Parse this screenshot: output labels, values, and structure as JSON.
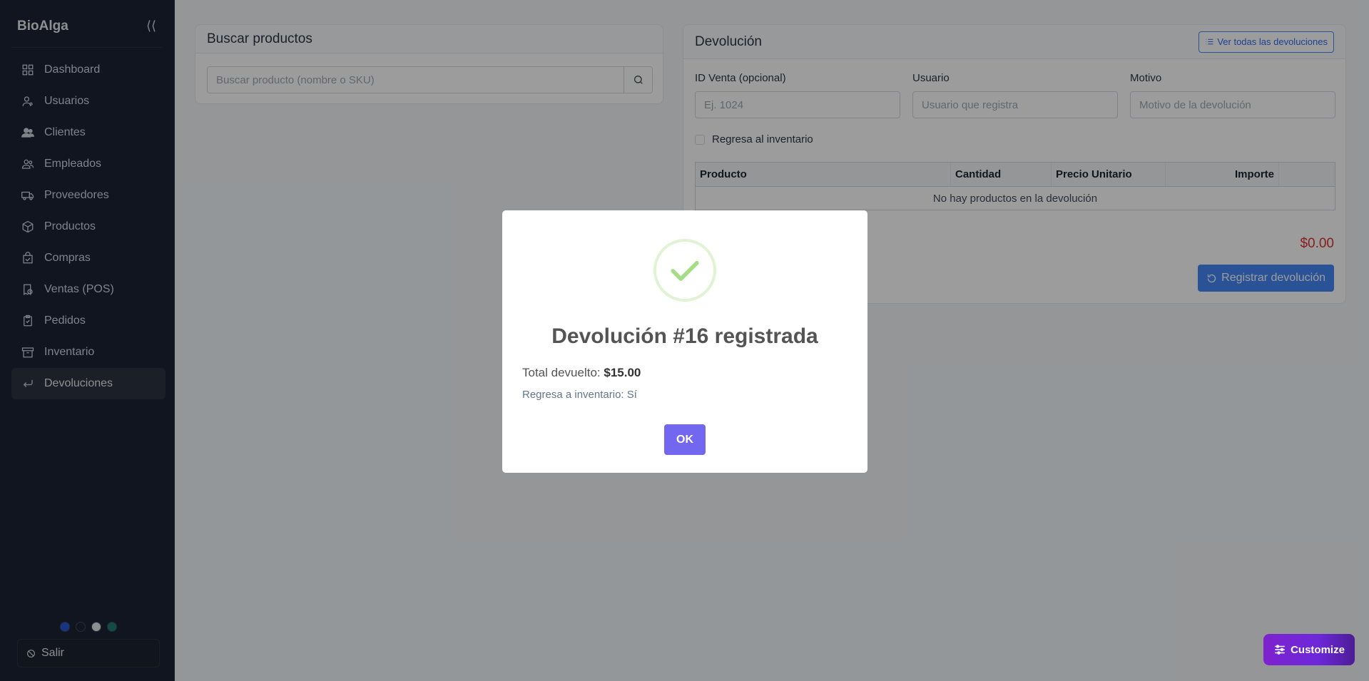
{
  "sidebar": {
    "brand": "BioAlga",
    "collapse_icon": "⟨⟨",
    "items": [
      {
        "label": "Dashboard",
        "icon": "grid-icon"
      },
      {
        "label": "Usuarios",
        "icon": "user-icon"
      },
      {
        "label": "Clientes",
        "icon": "users-icon"
      },
      {
        "label": "Empleados",
        "icon": "team-icon"
      },
      {
        "label": "Proveedores",
        "icon": "truck-icon"
      },
      {
        "label": "Productos",
        "icon": "box-icon"
      },
      {
        "label": "Compras",
        "icon": "bag-check-icon"
      },
      {
        "label": "Ventas (POS)",
        "icon": "receipt-icon"
      },
      {
        "label": "Pedidos",
        "icon": "clipboard-icon"
      },
      {
        "label": "Inventario",
        "icon": "archive-icon"
      },
      {
        "label": "Devoluciones",
        "icon": "return-icon",
        "active": true
      }
    ],
    "theme_dots": [
      "#2563eb",
      "#0f172a",
      "#e5e7eb",
      "#0d9488"
    ],
    "logout_label": "Salir"
  },
  "search": {
    "title": "Buscar productos",
    "placeholder": "Buscar producto (nombre o SKU)"
  },
  "devolucion": {
    "title": "Devolución",
    "view_all_label": "Ver todas las devoluciones",
    "fields": {
      "venta": {
        "label": "ID Venta (opcional)",
        "placeholder": "Ej. 1024"
      },
      "usuario": {
        "label": "Usuario",
        "placeholder": "Usuario que registra"
      },
      "motivo": {
        "label": "Motivo",
        "placeholder": "Motivo de la devolución"
      }
    },
    "checkbox_label": "Regresa al inventario",
    "table": {
      "headers": [
        "Producto",
        "Cantidad",
        "Precio Unitario",
        "Importe"
      ],
      "empty": "No hay productos en la devolución"
    },
    "total": "$0.00",
    "register_label": "Registrar devolución"
  },
  "modal": {
    "title": "Devolución #16 registrada",
    "total_label": "Total devuelto:",
    "total_value": "$15.00",
    "inventory_text": "Regresa a inventario: Sí",
    "ok_label": "OK"
  },
  "customize_label": "Customize"
}
